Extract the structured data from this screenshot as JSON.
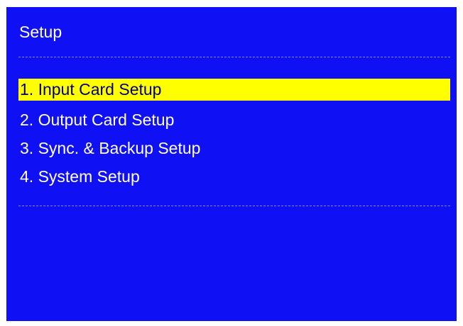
{
  "header": {
    "title": "Setup"
  },
  "menu": {
    "items": [
      {
        "label": "1. Input Card Setup",
        "selected": true
      },
      {
        "label": "2. Output Card Setup",
        "selected": false
      },
      {
        "label": "3. Sync. & Backup Setup",
        "selected": false
      },
      {
        "label": "4. System Setup",
        "selected": false
      }
    ]
  },
  "colors": {
    "background": "#1010f4",
    "text": "#ffffff",
    "highlight": "#ffff00",
    "highlight_text": "#000080"
  }
}
